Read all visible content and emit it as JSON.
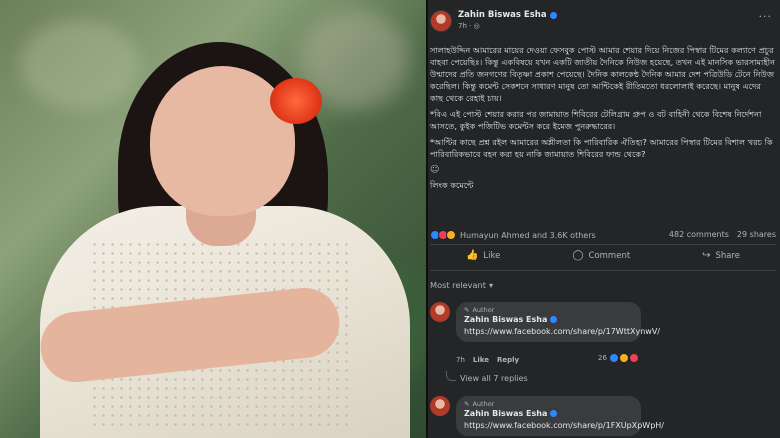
{
  "post": {
    "author": "Zahin Biswas Esha",
    "time": "7h · ",
    "globe_icon": "globe-icon",
    "more": "···",
    "paragraphs": [
      "সালাহউদ্দিন আমারের মায়ের দেওয়া ফেসবুক পোস্ট আমার শেয়ার দিয়ে নিজের পিস্বার টিমের কল্যাণে প্রচুর বাহবা পেয়েছিঃ। কিন্তু একবিষয়ে যখন একটি জাতীয় দৈনিকে নিউজ হয়েছে, তখন এই মানসিক ভারসাম্যহীন উন্মাদের প্রতি জনগণের বিতৃষ্ণা প্রকাশ পেয়েছে। দৈনিক কালকেন্ঠ দৈনিক আমার দেশ পত্রিউডি টেনে নিউজ করেছিল। কিন্তু কমেন্ট সেকশনে সাধারণ মানুষ তো আন্টিকেই রীতিমতো ধরলোলাই করেছে। মানুষ এদের কাছ থেকে রেহাই চায়।",
      "*বিএ এই পোস্ট শেয়ার করার পর জামায়াত শিবিরের টেলিগ্রাম গ্রুপ ও বট বাহিনী থেকে বিশেষ নির্দেশনা আসতে, কুইক পজিটিভ কমেন্টস করে ইমেজ পুনরুদ্ধারের।",
      "*আন্টির কাছে প্রশ্ন রইল আমারের অশ্লীলতা কি পারিবারিক ঐতিহ্য? আমারের পিস্বার টিমের বিশাল খরচ কি পারিবারিকভাবে বহন করা হয় নাকি জামায়াত শিবিরের ফান্ড থেকে?"
    ],
    "emoji_line": "☺",
    "link_label": "লিংক কমেন্টে"
  },
  "reactions": {
    "summary": "Humayun Ahmed and 3.6K others",
    "comments": "482 comments",
    "shares": "29 shares"
  },
  "actions": {
    "like": "Like",
    "comment": "Comment",
    "share": "Share"
  },
  "sort": {
    "label": "Most relevant",
    "chevron": "▾"
  },
  "comments": [
    {
      "badge": "Author",
      "name": "Zahin Biswas Esha",
      "text": "https://www.facebook.com/share/p/17WttXynwV/",
      "time": "7h",
      "like": "Like",
      "reply": "Reply",
      "react_count": "26",
      "view_replies": "View all 7 replies"
    },
    {
      "badge": "Author",
      "name": "Zahin Biswas Esha",
      "text": "https://www.facebook.com/share/p/1FXUpXpWpH/"
    }
  ],
  "colors": {
    "panel": "#242526",
    "bubble": "#3a3b3c",
    "text": "#e4e6eb",
    "muted": "#b0b3b8",
    "accent": "#2d88ff"
  }
}
